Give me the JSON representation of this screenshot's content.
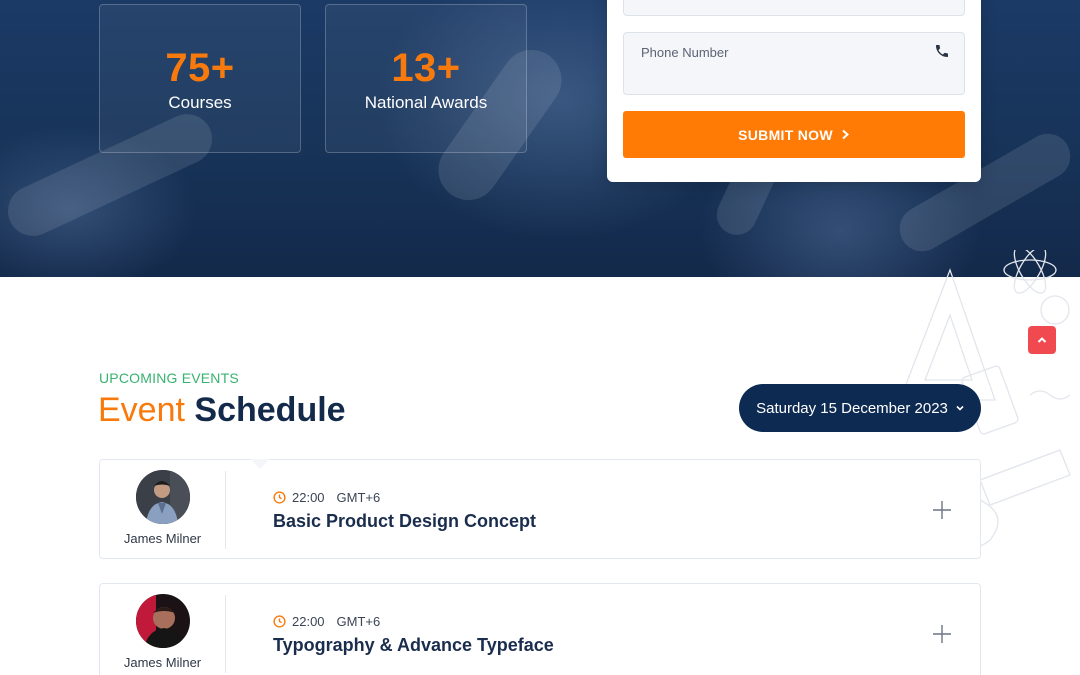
{
  "hero": {
    "stats": [
      {
        "value": "75+",
        "label": "Courses"
      },
      {
        "value": "13+",
        "label": "National Awards"
      }
    ],
    "form": {
      "phone_placeholder": "Phone Number",
      "submit_label": "SUBMIT NOW"
    }
  },
  "events": {
    "kicker": "UPCOMING EVENTS",
    "title_part1": "Event",
    "title_part2": "Schedule",
    "date_selector": "Saturday 15 December 2023",
    "items": [
      {
        "speaker": "James Milner",
        "time": "22:00",
        "timezone": "GMT+6",
        "title": "Basic Product Design Concept"
      },
      {
        "speaker": "James Milner",
        "time": "22:00",
        "timezone": "GMT+6",
        "title": "Typography & Advance Typeface"
      }
    ]
  },
  "colors": {
    "accent": "#f97a0c",
    "navy": "#0d2a52",
    "kicker_green": "#37b26f",
    "scroll_top": "#f0494f"
  },
  "icons": [
    "phone-icon",
    "chevron-right-icon",
    "chevron-down-icon",
    "clock-icon",
    "plus-icon",
    "chevron-up-icon"
  ]
}
